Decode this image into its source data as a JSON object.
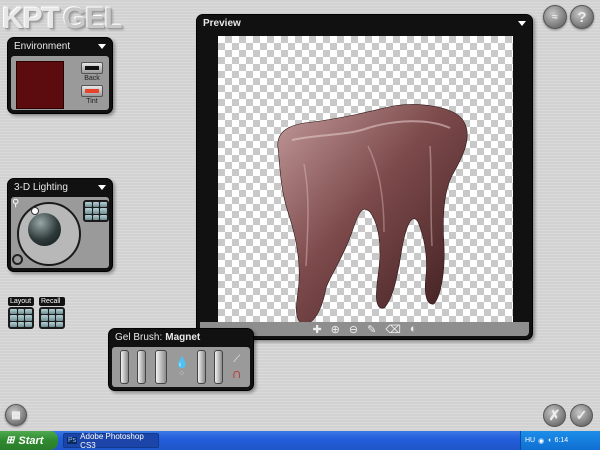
{
  "app": {
    "logo_kpt": "KPT",
    "logo_gel": "GEL"
  },
  "top_buttons": {
    "help_label": "?"
  },
  "environment": {
    "title": "Environment",
    "back_label": "Back",
    "tint_label": "Tint",
    "swatch_color": "#5c0c0f",
    "tint_color": "#e8432a"
  },
  "lighting": {
    "title": "3-D Lighting"
  },
  "presets": {
    "layout_label": "Layout",
    "recall_label": "Recall"
  },
  "preview": {
    "title": "Preview",
    "object_color": "#7d4a4b"
  },
  "brush": {
    "label": "Gel Brush:",
    "name": "Magnet"
  },
  "actions": {
    "cancel_label": "✗",
    "ok_label": "✓"
  },
  "taskbar": {
    "start_label": "Start",
    "task_label": "Adobe Photoshop CS3",
    "lang": "HU",
    "time": "6:14"
  }
}
